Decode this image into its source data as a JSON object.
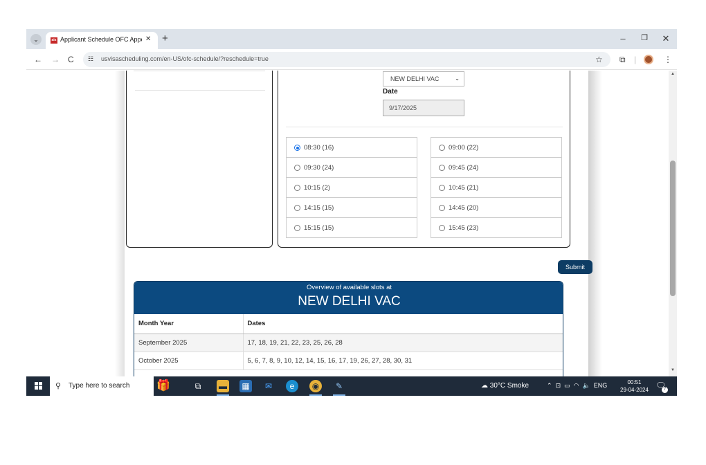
{
  "browser": {
    "tab_title": "Applicant Schedule OFC Appoi",
    "tab_favicon_text": "ais",
    "url": "usvisascheduling.com/en-US/ofc-schedule/?reschedule=true"
  },
  "form": {
    "location_value": "NEW DELHI VAC",
    "date_label": "Date",
    "date_value": "9/17/2025",
    "slots": [
      {
        "label": "08:30 (16)",
        "selected": true
      },
      {
        "label": "09:00 (22)",
        "selected": false
      },
      {
        "label": "09:30 (24)",
        "selected": false
      },
      {
        "label": "09:45 (24)",
        "selected": false
      },
      {
        "label": "10:15 (2)",
        "selected": false
      },
      {
        "label": "10:45 (21)",
        "selected": false
      },
      {
        "label": "14:15 (15)",
        "selected": false
      },
      {
        "label": "14:45 (20)",
        "selected": false
      },
      {
        "label": "15:15 (15)",
        "selected": false
      },
      {
        "label": "15:45 (23)",
        "selected": false
      }
    ],
    "submit_label": "Submit"
  },
  "overview": {
    "subtitle": "Overview of available slots at",
    "title": "NEW DELHI VAC",
    "headers": [
      "Month Year",
      "Dates"
    ],
    "rows": [
      [
        "September 2025",
        "17, 18, 19, 21, 22, 23, 25, 26, 28"
      ],
      [
        "October 2025",
        "5, 6, 7, 8, 9, 10, 12, 14, 15, 16, 17, 19, 26, 27, 28, 30, 31"
      ]
    ]
  },
  "taskbar": {
    "search_placeholder": "Type here to search",
    "weather": "30°C  Smoke",
    "language": "ENG",
    "time": "00:51",
    "date": "29-04-2024",
    "notification_count": "7"
  },
  "colors": {
    "brand_navy": "#0c4a80",
    "submit_navy": "#0d3c64",
    "radio_selected": "#1a73e8"
  }
}
